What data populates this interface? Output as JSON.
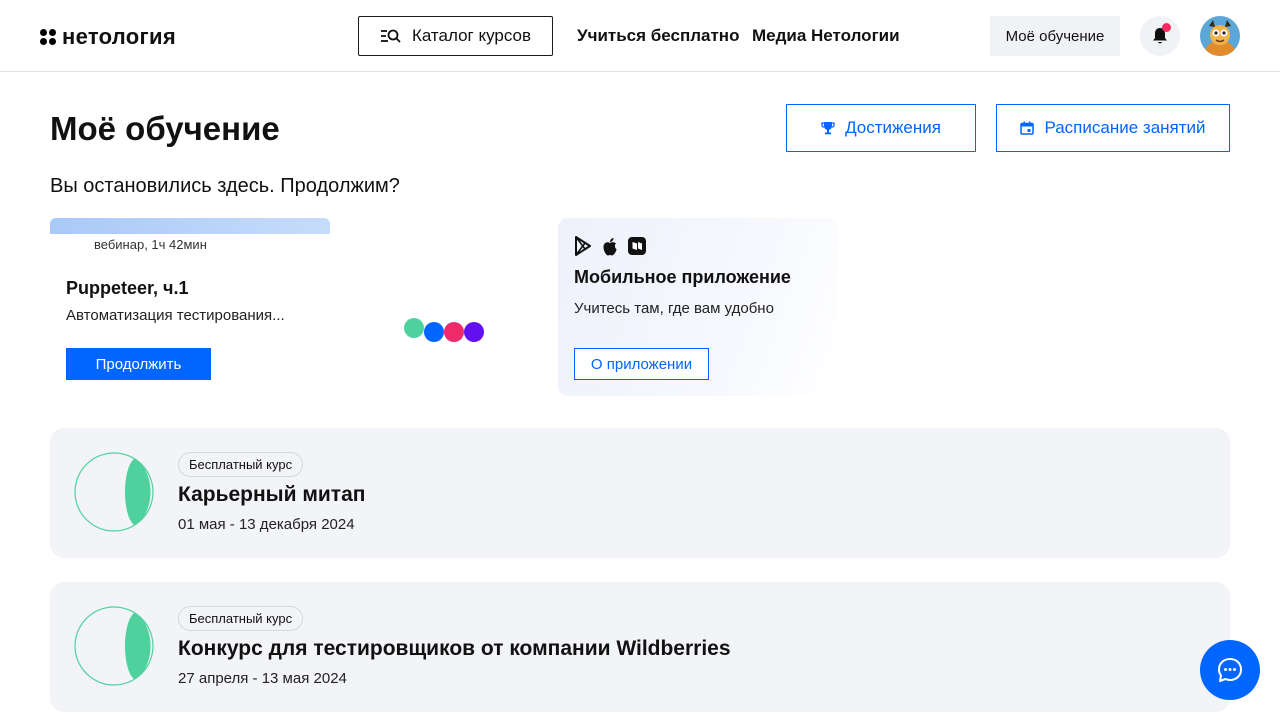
{
  "header": {
    "logo_text": "нетология",
    "catalog_label": "Каталог курсов",
    "nav": [
      "Учиться бесплатно",
      "Медиа Нетологии"
    ],
    "my_learning_label": "Моё обучение"
  },
  "main": {
    "title": "Моё обучение",
    "achievements_label": "Достижения",
    "schedule_label": "Расписание занятий",
    "subtitle": "Вы остановились здесь. Продолжим?"
  },
  "continue_card": {
    "meta": "вебинар, 1ч 42мин",
    "title": "Puppeteer, ч.1",
    "description": "Автоматизация тестирования...",
    "button_label": "Продолжить"
  },
  "app_card": {
    "title": "Мобильное приложение",
    "description": "Учитесь там, где вам удобно",
    "button_label": "О приложении"
  },
  "events": [
    {
      "badge": "Бесплатный курс",
      "title": "Карьерный митап",
      "dates": "01 мая - 13 декабря 2024"
    },
    {
      "badge": "Бесплатный курс",
      "title": "Конкурс для тестировщиков от компании Wildberries",
      "dates": "27 апреля - 13 мая 2024"
    }
  ],
  "colors": {
    "accent": "#0066ff",
    "notification_dot": "#ff2b60",
    "event_icon_green": "#4fd19e",
    "loader_dots": [
      "#4fd19e",
      "#0066ff",
      "#ee2a6b",
      "#6210f0"
    ]
  }
}
